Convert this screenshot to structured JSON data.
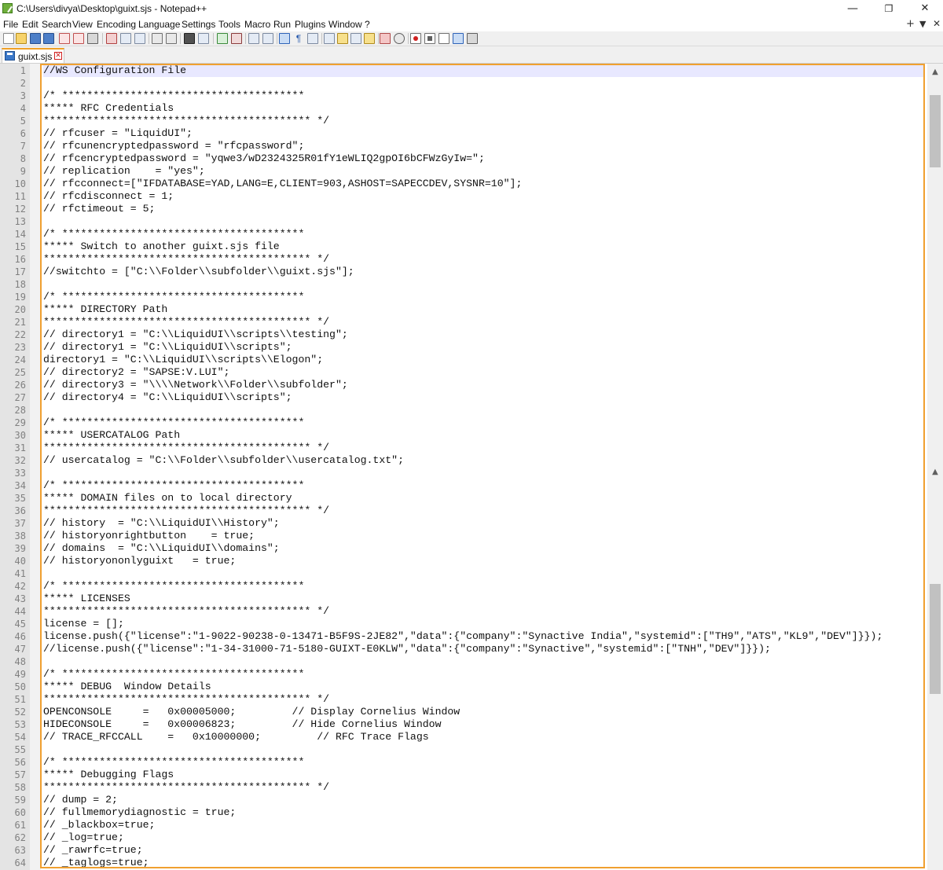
{
  "window": {
    "title": "C:\\Users\\divya\\Desktop\\guixt.sjs - Notepad++",
    "minimize_glyph": "—",
    "maximize_glyph": "❐",
    "close_glyph": "✕"
  },
  "menu": {
    "items": [
      "File",
      "Edit",
      "Search",
      "View",
      "Encoding",
      "Language",
      "Settings",
      "Tools",
      "Macro",
      "Run",
      "Plugins",
      "Window",
      "?"
    ],
    "right_glyphs": [
      "+",
      "▼",
      "✕"
    ]
  },
  "toolbar": {
    "icons": [
      "new-file-icon",
      "open-file-icon",
      "save-icon",
      "save-all-icon",
      "close-icon",
      "close-all-icon",
      "print-icon",
      "cut-icon",
      "copy-icon",
      "paste-icon",
      "undo-icon",
      "redo-icon",
      "find-icon",
      "replace-icon",
      "zoom-in-icon",
      "zoom-out-icon",
      "sync-vertical-icon",
      "sync-horizontal-icon",
      "word-wrap-icon",
      "show-all-chars-icon",
      "indent-guide-icon",
      "user-language-icon",
      "doc-map-icon",
      "function-list-icon",
      "folder-as-workspace-icon",
      "monitoring-icon",
      "record-macro-icon",
      "stop-macro-icon",
      "play-macro-icon",
      "run-macro-multiple-icon",
      "save-macro-icon"
    ]
  },
  "tab": {
    "label": "guixt.sjs",
    "close_glyph": "✕"
  },
  "editor": {
    "lines": [
      "//WS Configuration File",
      "",
      "/* ***************************************",
      "***** RFC Credentials",
      "******************************************* */",
      "// rfcuser = \"LiquidUI\";",
      "// rfcunencryptedpassword = \"rfcpassword\";",
      "// rfcencryptedpassword = \"yqwe3/wD2324325R01fY1eWLIQ2gpOI6bCFWzGyIw=\";",
      "// replication    = \"yes\";",
      "// rfcconnect=[\"IFDATABASE=YAD,LANG=E,CLIENT=903,ASHOST=SAPECCDEV,SYSNR=10\"];",
      "// rfcdisconnect = 1;",
      "// rfctimeout = 5;",
      "",
      "/* ***************************************",
      "***** Switch to another guixt.sjs file",
      "******************************************* */",
      "//switchto = [\"C:\\\\Folder\\\\subfolder\\\\guixt.sjs\"];",
      "",
      "/* ***************************************",
      "***** DIRECTORY Path",
      "******************************************* */",
      "// directory1 = \"C:\\\\LiquidUI\\\\scripts\\\\testing\";",
      "// directory1 = \"C:\\\\LiquidUI\\\\scripts\";",
      "directory1 = \"C:\\\\LiquidUI\\\\scripts\\\\Elogon\";",
      "// directory2 = \"SAPSE:V.LUI\";",
      "// directory3 = \"\\\\\\\\Network\\\\Folder\\\\subfolder\";",
      "// directory4 = \"C:\\\\LiquidUI\\\\scripts\";",
      "",
      "/* ***************************************",
      "***** USERCATALOG Path",
      "******************************************* */",
      "// usercatalog = \"C:\\\\Folder\\\\subfolder\\\\usercatalog.txt\";",
      "",
      "/* ***************************************",
      "***** DOMAIN files on to local directory",
      "******************************************* */",
      "// history  = \"C:\\\\LiquidUI\\\\History\";",
      "// historyonrightbutton    = true;",
      "// domains  = \"C:\\\\LiquidUI\\\\domains\";",
      "// historyononlyguixt   = true;",
      "",
      "/* ***************************************",
      "***** LICENSES",
      "******************************************* */",
      "license = [];",
      "license.push({\"license\":\"1-9022-90238-0-13471-B5F9S-2JE82\",\"data\":{\"company\":\"Synactive India\",\"systemid\":[\"TH9\",\"ATS\",\"KL9\",\"DEV\"]}});",
      "//license.push({\"license\":\"1-34-31000-71-5180-GUIXT-E0KLW\",\"data\":{\"company\":\"Synactive\",\"systemid\":[\"TNH\",\"DEV\"]}});",
      "",
      "/* ***************************************",
      "***** DEBUG  Window Details",
      "******************************************* */",
      "OPENCONSOLE     =   0x00005000;         // Display Cornelius Window",
      "HIDECONSOLE     =   0x00006823;         // Hide Cornelius Window",
      "// TRACE_RFCCALL    =   0x10000000;         // RFC Trace Flags",
      "",
      "/* ***************************************",
      "***** Debugging Flags",
      "******************************************* */",
      "// dump = 2;",
      "// fullmemorydiagnostic = true;",
      "// _blackbox=true;",
      "// _log=true;",
      "// _rawrfc=true;",
      "// _taglogs=true;"
    ]
  },
  "scrollbar": {
    "up_glyph": "▲",
    "down_glyph": "▼"
  }
}
